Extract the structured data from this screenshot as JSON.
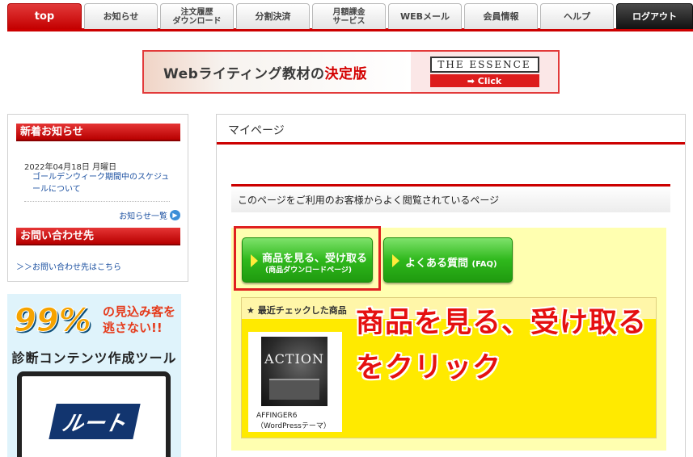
{
  "nav": {
    "tabs": [
      {
        "label": "top"
      },
      {
        "label": "お知らせ"
      },
      {
        "label1": "注文履歴",
        "label2": "ダウンロード"
      },
      {
        "label": "分割決済"
      },
      {
        "label1": "月額課金",
        "label2": "サービス"
      },
      {
        "label": "WEBメール"
      },
      {
        "label": "会員情報"
      },
      {
        "label": "ヘルプ"
      },
      {
        "label": "ログアウト"
      }
    ]
  },
  "banner": {
    "text_prefix": "Webライティング教材の",
    "text_highlight": "決定版",
    "brand": "THE ESSENCE",
    "click": "➡ Click"
  },
  "sidebar": {
    "news_title": "新着お知らせ",
    "news_date": "2022年04月18日 月曜日",
    "news_link": "ゴールデンウィーク期間中のスケジュールについて",
    "news_more": "お知らせ一覧",
    "contact_title": "お問い合わせ先",
    "contact_link": "＞＞お問い合わせ先はこちら",
    "ad": {
      "percent": "99%",
      "line1": "の見込み客を",
      "line2": "逃さない!!",
      "title": "診断コンテンツ作成ツール",
      "logo": "ルート"
    }
  },
  "main": {
    "title": "マイページ",
    "subtitle": "このページをご利用のお客様からよく閲覧されているページ",
    "btn_products_l1": "商品を見る、受け取る",
    "btn_products_l2": "(商品ダウンロードページ)",
    "btn_faq_main": "よくある質問",
    "btn_faq_sub": "(FAQ)",
    "recent_title": "★ 最近チェックした商品",
    "product": {
      "image_text": "ACTION",
      "name": "AFFINGER6（WordPressテーマ）"
    }
  },
  "annotation": {
    "line1": "商品を見る、受け取る",
    "line2": "をクリック"
  },
  "colors": {
    "accent_red": "#cc0000",
    "button_green": "#2fb81c",
    "panel_yellow": "#ffea00",
    "annotation_red": "#e51010"
  }
}
